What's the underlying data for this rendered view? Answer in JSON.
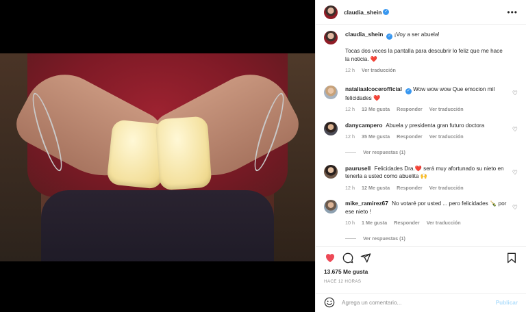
{
  "header": {
    "username": "claudia_shein",
    "verified": true
  },
  "caption": {
    "username": "claudia_shein",
    "line1": "¡Voy a ser abuela!",
    "line2": "Tocas dos veces la pantalla para descubrir lo feliz que me hace la noticia. ❤️",
    "time": "12 h",
    "translate": "Ver traducción"
  },
  "comments": [
    {
      "username": "nataliaalcocerofficial",
      "verified": true,
      "text": "Wow wow wow Que emocion mil felicidades ❤️",
      "time": "12 h",
      "likes": "13 Me gusta",
      "reply": "Responder",
      "translate": "Ver traducción"
    },
    {
      "username": "danycampero",
      "verified": false,
      "text": "Abuela y presidenta gran futuro doctora",
      "time": "12 h",
      "likes": "35 Me gusta",
      "reply": "Responder",
      "translate": "Ver traducción",
      "replies": "Ver respuestas (1)"
    },
    {
      "username": "paurusell",
      "verified": false,
      "text": "Felicidades Dra.❤️ será muy afortunado su nieto en tenerla a usted como abuelita 🙌",
      "time": "12 h",
      "likes": "12 Me gusta",
      "reply": "Responder",
      "translate": "Ver traducción"
    },
    {
      "username": "mike_ramirez67",
      "verified": false,
      "text": "No votaré por usted ... pero felicidades 🍾 por ese nieto !",
      "time": "10 h",
      "likes": "1 Me gusta",
      "reply": "Responder",
      "translate": "Ver traducción",
      "replies": "Ver respuestas (1)"
    }
  ],
  "actions": {
    "icons": [
      "heart-filled-icon",
      "comment-icon",
      "share-icon",
      "bookmark-icon"
    ],
    "like_color": "#ed4956"
  },
  "likes_count": "13.675 Me gusta",
  "posted": "HACE 12 HORAS",
  "add_comment": {
    "placeholder": "Agrega un comentario...",
    "publish": "Publicar"
  },
  "colors": {
    "verified": "#3897f0",
    "muted": "#8e8e8e",
    "publish": "#b2dffc"
  }
}
